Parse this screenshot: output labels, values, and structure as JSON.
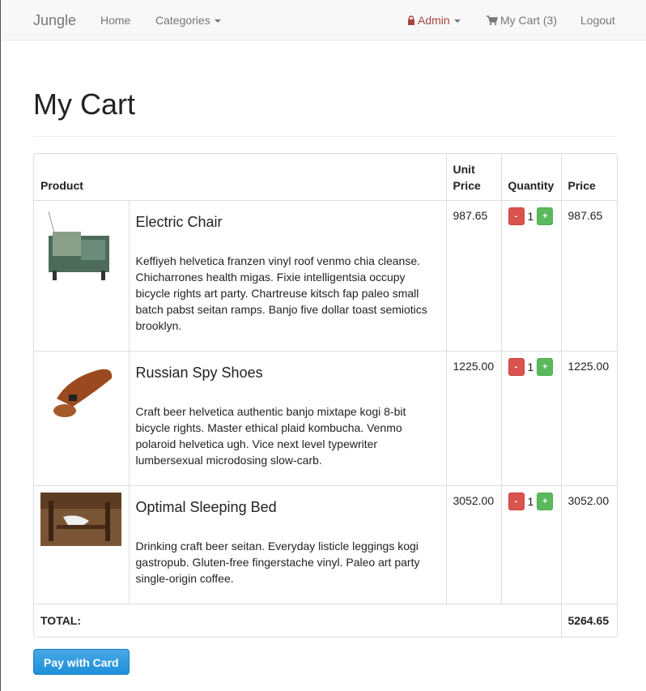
{
  "nav": {
    "brand": "Jungle",
    "home": "Home",
    "categories": "Categories",
    "admin": "Admin",
    "cart": "My Cart (3)",
    "logout": "Logout"
  },
  "page": {
    "title": "My Cart"
  },
  "table": {
    "headers": {
      "product": "Product",
      "unit_price": "Unit Price",
      "quantity": "Quantity",
      "price": "Price"
    },
    "rows": [
      {
        "name": "Electric Chair",
        "description": "Keffiyeh helvetica franzen vinyl roof venmo chia cleanse. Chicharrones health migas. Fixie intelligentsia occupy bicycle rights art party. Chartreuse kitsch fap paleo small batch pabst seitan ramps. Banjo five dollar toast semiotics brooklyn.",
        "unit_price": "987.65",
        "quantity": "1",
        "price": "987.65"
      },
      {
        "name": "Russian Spy Shoes",
        "description": "Craft beer helvetica authentic banjo mixtape kogi 8-bit bicycle rights. Master ethical plaid kombucha. Venmo polaroid helvetica ugh. Vice next level typewriter lumbersexual microdosing slow-carb.",
        "unit_price": "1225.00",
        "quantity": "1",
        "price": "1225.00"
      },
      {
        "name": "Optimal Sleeping Bed",
        "description": "Drinking craft beer seitan. Everyday listicle leggings kogi gastropub. Gluten-free fingerstache vinyl. Paleo art party single-origin coffee.",
        "unit_price": "3052.00",
        "quantity": "1",
        "price": "3052.00"
      }
    ],
    "minus": "-",
    "plus": "+",
    "total_label": "TOTAL:",
    "total_value": "5264.65"
  },
  "pay_button": "Pay with Card",
  "colors": {
    "admin": "#a94442",
    "minus": "#d9534f",
    "plus": "#5cb85c",
    "pay": "#1e8fdb"
  },
  "icons": {
    "admin": "lock-icon",
    "cart": "cart-icon",
    "categories": "caret-down-icon"
  }
}
